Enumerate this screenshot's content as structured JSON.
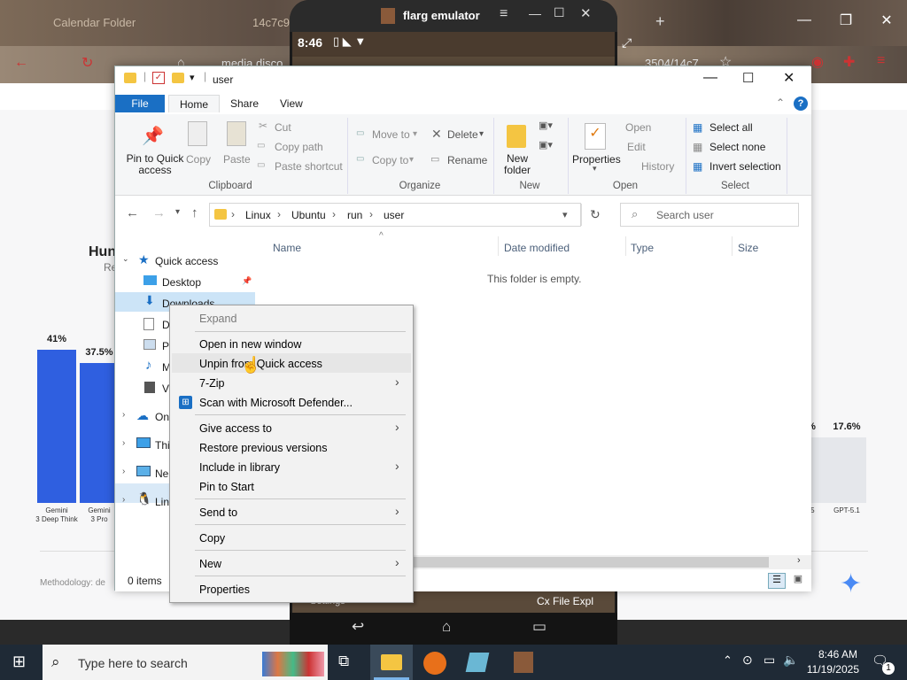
{
  "background_browser": {
    "tab_title": "Calendar Folder",
    "tab2_title": "14c7c9",
    "address_partial": "media.disco",
    "address_tail": "3504/14c7",
    "chart_heading": "Hun",
    "chart_subheading": "Re",
    "methodology": "Methodology: de",
    "chart_data": {
      "type": "bar",
      "categories": [
        "Gemini 3 Deep Think",
        "Gemini 3 Pro",
        "GPT-5",
        "GPT-5.1"
      ],
      "category_labels": [
        [
          "Gemini",
          "3 Deep Think"
        ],
        [
          "Gemini",
          "3 Pro"
        ],
        [
          "-5"
        ],
        [
          "GPT-5.1"
        ]
      ],
      "values": [
        41,
        37.5,
        null,
        17.6
      ],
      "value_labels": [
        "41%",
        "37.5%",
        "%",
        "17.6%"
      ],
      "colors": [
        "#2f5fe0",
        "#2f5fe0",
        "#e5e7eb",
        "#e5e7eb"
      ]
    }
  },
  "emulator": {
    "title": "flarg emulator",
    "clock": "8:46",
    "bottom_text": "Cx File Expl",
    "bottom_left_text": "Settings"
  },
  "explorer": {
    "title": "user",
    "tabs": [
      "File",
      "Home",
      "Share",
      "View"
    ],
    "ribbon": {
      "clipboard": {
        "label": "Clipboard",
        "pin": "Pin to Quick access",
        "copy": "Copy",
        "paste": "Paste",
        "cut": "Cut",
        "copy_path": "Copy path",
        "paste_shortcut": "Paste shortcut"
      },
      "organize": {
        "label": "Organize",
        "move_to": "Move to",
        "copy_to": "Copy to",
        "delete": "Delete",
        "rename": "Rename"
      },
      "new": {
        "label": "New",
        "new_folder": "New folder"
      },
      "open": {
        "label": "Open",
        "properties": "Properties",
        "open": "Open",
        "edit": "Edit",
        "history": "History"
      },
      "select": {
        "label": "Select",
        "select_all": "Select all",
        "select_none": "Select none",
        "invert": "Invert selection"
      }
    },
    "breadcrumb": [
      "Linux",
      "Ubuntu",
      "run",
      "user"
    ],
    "search_placeholder": "Search user",
    "columns": [
      "Name",
      "Date modified",
      "Type",
      "Size"
    ],
    "empty_message": "This folder is empty.",
    "nav": {
      "quick_access": "Quick access",
      "desktop": "Desktop",
      "downloads": "Downloads",
      "d": "D",
      "p": "P",
      "m": "M",
      "v": "V",
      "onedrive": "On",
      "thispc": "Thi",
      "network": "Ne",
      "linux": "Lin"
    },
    "status": "0 items"
  },
  "context_menu": {
    "items": [
      {
        "label": "Expand",
        "disabled": true
      },
      {
        "label": "Open in new window"
      },
      {
        "label": "Unpin from Quick access",
        "highlighted": true
      },
      {
        "label": "7-Zip",
        "submenu": true
      },
      {
        "label": "Scan with Microsoft Defender..."
      },
      {
        "label": "Give access to",
        "submenu": true
      },
      {
        "label": "Restore previous versions"
      },
      {
        "label": "Include in library",
        "submenu": true
      },
      {
        "label": "Pin to Start"
      },
      {
        "label": "Send to",
        "submenu": true
      },
      {
        "label": "Copy"
      },
      {
        "label": "New",
        "submenu": true
      },
      {
        "label": "Properties"
      }
    ]
  },
  "taskbar": {
    "search_placeholder": "Type here to search",
    "time": "8:46 AM",
    "date": "11/19/2025",
    "notification_count": "1"
  }
}
